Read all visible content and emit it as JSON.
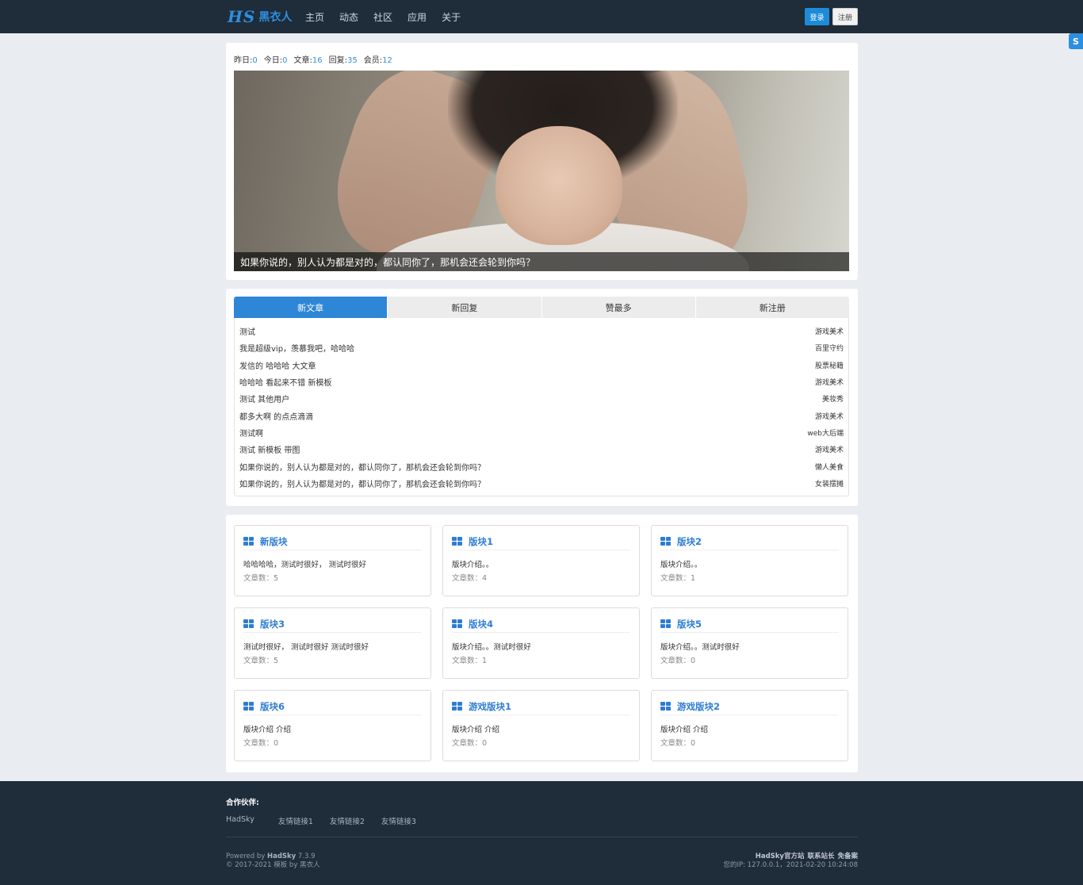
{
  "header": {
    "logo_mark": "HS",
    "logo_text": "黑衣人",
    "nav": [
      "主页",
      "动态",
      "社区",
      "应用",
      "关于"
    ],
    "login_label": "登录",
    "register_label": "注册",
    "side_widget_icon": "S"
  },
  "stats": [
    {
      "label": "昨日:",
      "value": "0"
    },
    {
      "label": "今日:",
      "value": "0"
    },
    {
      "label": "文章:",
      "value": "16"
    },
    {
      "label": "回复:",
      "value": "35"
    },
    {
      "label": "会员:",
      "value": "12"
    }
  ],
  "banner": {
    "caption": "如果你说的，别人认为都是对的，都认同你了，那机会还会轮到你吗？"
  },
  "tabs": [
    "新文章",
    "新回复",
    "赞最多",
    "新注册"
  ],
  "articles": [
    {
      "title": "测试",
      "category": "游戏美术"
    },
    {
      "title": "我是超级vip，羡慕我吧，哈哈哈",
      "category": "百里守约"
    },
    {
      "title": "发信的 哈哈哈 大文章",
      "category": "股票秘籍"
    },
    {
      "title": "哈哈哈 看起来不错 新模板",
      "category": "游戏美术"
    },
    {
      "title": "测试 其他用户",
      "category": "美妆秀"
    },
    {
      "title": "都多大啊 的点点滴滴",
      "category": "游戏美术"
    },
    {
      "title": "测试啊",
      "category": "web大后端"
    },
    {
      "title": "测试 新模板 带图",
      "category": "游戏美术"
    },
    {
      "title": "如果你说的，别人认为都是对的，都认同你了，那机会还会轮到你吗？",
      "category": "懒人美食"
    },
    {
      "title": "如果你说的，别人认为都是对的，都认同你了，那机会还会轮到你吗？",
      "category": "女装摆摊"
    }
  ],
  "boards": [
    {
      "name": "新版块",
      "desc": "哈哈哈哈，测试时很好，  测试时很好",
      "count": "文章数：5"
    },
    {
      "name": "版块1",
      "desc": "版块介绍。。",
      "count": "文章数：4"
    },
    {
      "name": "版块2",
      "desc": "版块介绍。。",
      "count": "文章数：1"
    },
    {
      "name": "版块3",
      "desc": "测试时很好，  测试时很好 测试时很好",
      "count": "文章数：5"
    },
    {
      "name": "版块4",
      "desc": "版块介绍。。测试时很好",
      "count": "文章数：1"
    },
    {
      "name": "版块5",
      "desc": "版块介绍。。测试时很好",
      "count": "文章数：0"
    },
    {
      "name": "版块6",
      "desc": "版块介绍 介绍",
      "count": "文章数：0"
    },
    {
      "name": "游戏版块1",
      "desc": "版块介绍 介绍",
      "count": "文章数：0"
    },
    {
      "name": "游戏版块2",
      "desc": "版块介绍 介绍",
      "count": "文章数：0"
    }
  ],
  "footer": {
    "partners_title": "合作伙伴:",
    "links": [
      "HadSky",
      "友情链接1",
      "友情链接2",
      "友情链接3"
    ],
    "powered_prefix": "Powered by",
    "powered_name": "HadSky",
    "powered_version": "7.3.9",
    "copyright": "© 2017-2021 模板 by 黑衣人",
    "right_links": [
      "HadSky官方站",
      "联系站长",
      "免备案"
    ],
    "ip_line": "您的IP: 127.0.0.1，2021-02-20 10:24:08"
  }
}
